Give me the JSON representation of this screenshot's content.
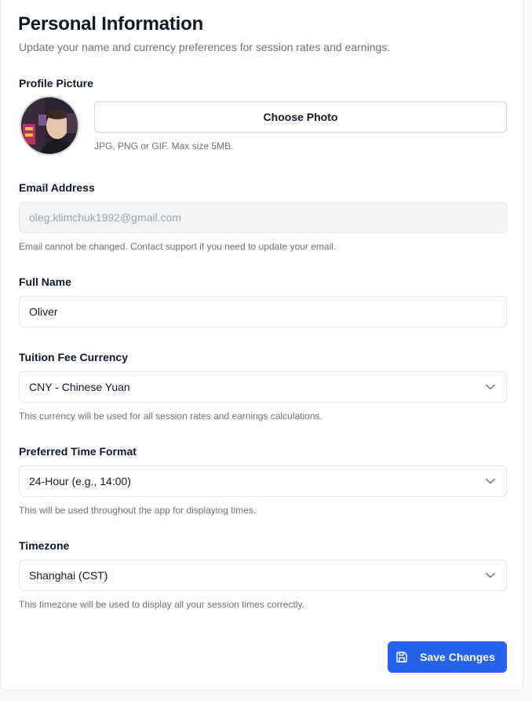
{
  "header": {
    "title": "Personal Information",
    "subtitle": "Update your name and currency preferences for session rates and earnings."
  },
  "profile_picture": {
    "label": "Profile Picture",
    "button_label": "Choose Photo",
    "help": "JPG, PNG or GIF. Max size 5MB."
  },
  "email": {
    "label": "Email Address",
    "value": "oleg.klimchuk1992@gmail.com",
    "help": "Email cannot be changed. Contact support if you need to update your email."
  },
  "full_name": {
    "label": "Full Name",
    "value": "Oliver"
  },
  "currency": {
    "label": "Tuition Fee Currency",
    "selected": "CNY - Chinese Yuan",
    "help": "This currency will be used for all session rates and earnings calculations."
  },
  "time_format": {
    "label": "Preferred Time Format",
    "selected": "24-Hour (e.g., 14:00)",
    "help": "This will be used throughout the app for displaying times."
  },
  "timezone": {
    "label": "Timezone",
    "selected": "Shanghai (CST)",
    "help": "This timezone will be used to display all your session times correctly."
  },
  "actions": {
    "save_label": "Save Changes"
  },
  "icons": {
    "select_chevron": "chevron-down-icon",
    "save": "save-icon"
  },
  "colors": {
    "primary": "#2563eb",
    "text": "#111827",
    "muted": "#6b7280",
    "border": "#e5e7eb",
    "disabled_bg": "#f3f4f6"
  }
}
